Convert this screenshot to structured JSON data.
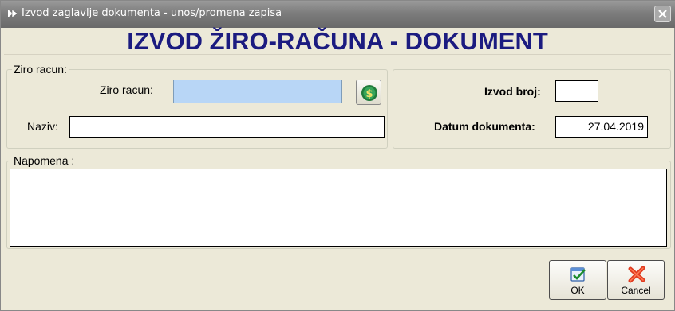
{
  "window": {
    "title": "Izvod zaglavlje dokumenta - unos/promena zapisa"
  },
  "heading": "IZVOD ŽIRO-RAČUNA - DOKUMENT",
  "ziro_group": {
    "legend": "Ziro racun:",
    "ziro_label": "Ziro racun:",
    "ziro_value": "",
    "naziv_label": "Naziv:",
    "naziv_value": ""
  },
  "right_group": {
    "izvod_label": "Izvod broj:",
    "izvod_value": "",
    "datum_label": "Datum dokumenta:",
    "datum_value": "27.04.2019"
  },
  "napomena": {
    "legend": "Napomena :",
    "value": ""
  },
  "buttons": {
    "ok": "OK",
    "cancel": "Cancel"
  },
  "icons": {
    "app": "app-icon",
    "close": "close-icon",
    "lookup": "dollar-coin-icon",
    "ok": "checkmark-icon",
    "cancel": "red-x-icon"
  },
  "colors": {
    "heading": "#1b1b80",
    "highlight_field": "#b8d6f6"
  }
}
